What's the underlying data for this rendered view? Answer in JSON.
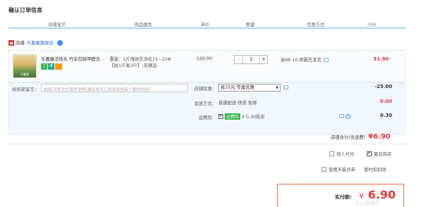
{
  "page_title": "确认订单信息",
  "columns": [
    "店铺宝贝",
    "商品属性",
    "单价",
    "数量",
    "优惠方式",
    "小计"
  ],
  "shop": {
    "prefix": "店铺:",
    "name": "乐嘉康旗舰店"
  },
  "item": {
    "thumb_text": "乐嘉康",
    "name": "乐嘉康活性炭 竹炭包除甲醛去...",
    "badges": [
      "7",
      "考"
    ],
    "props_line1": "重量：1斤强效去净化15~20#",
    "props_line2": "【拍1斤发2斤】:无赠品",
    "price": "120.00",
    "qty_minus": "-",
    "qty_value": "1",
    "qty_plus": "+",
    "promo": "省88.10:称霸先发货",
    "subtotal": "31.90"
  },
  "memo": {
    "label": "给卖家留言：",
    "placeholder": "选填(对本次交易的说明(建议填写已和卖家协商一致的内容)"
  },
  "shop_promo": {
    "label": "店铺优惠:",
    "selected": "省25元:专属优惠",
    "value": "-25.00"
  },
  "shipping": {
    "label": "运送方式:",
    "text": "普通配送 快递 免邮",
    "value": "0.00"
  },
  "insurance": {
    "label": "运费险:",
    "tag": "运费险",
    "text": "¥ 0.30购买",
    "value": "0.30"
  },
  "shop_total": {
    "label": "店铺合计(含运费)",
    "amount": "¥6.90"
  },
  "options": {
    "pay_for_me": "找人代付",
    "anonymous": "匿名购买",
    "tmall_points": "使用天猫点券",
    "tmall_points_status": "暂时扣扣除"
  },
  "payment": {
    "label": "实付款:",
    "currency": "¥",
    "amount": "6.90"
  },
  "watermark": "什么值得买"
}
